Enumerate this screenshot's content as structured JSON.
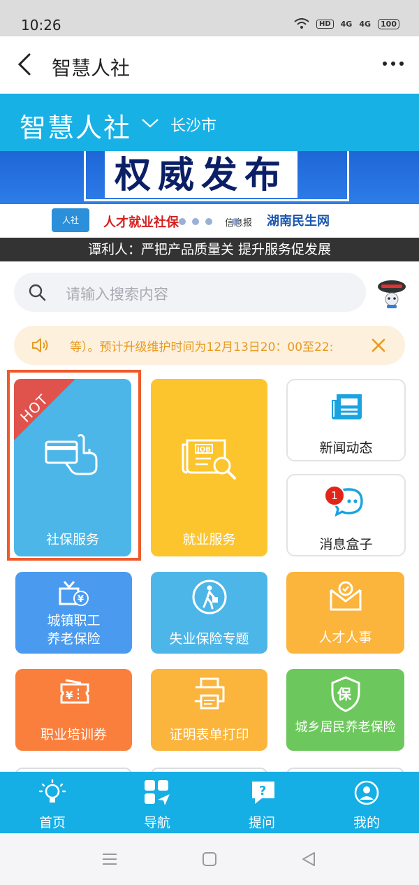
{
  "status_bar": {
    "time": "10:26",
    "hd": "HD",
    "net1": "4G",
    "net2": "4G",
    "battery": "100"
  },
  "app_bar": {
    "title": "智慧人社"
  },
  "header": {
    "brand": "智慧人社",
    "city": "长沙市"
  },
  "banner": {
    "headline": "权威发布",
    "logo_left": "人社",
    "logo_mid": "人才就业社保",
    "logo_mid_sub": "信息报",
    "logo_right": "湖南民生网",
    "slides": 5,
    "active_slide": 4
  },
  "news_caption": "谭利人：严把产品质量关 提升服务促发展",
  "search": {
    "placeholder": "请输入搜索内容"
  },
  "notice": {
    "text": "等）。预计升级维护时间为12月13日20：00至22:"
  },
  "tiles": {
    "social_insurance": {
      "label": "社保服务",
      "hot": "HOT",
      "color": "#4db6e8"
    },
    "employment": {
      "label": "就业服务",
      "color": "#fcc52e"
    },
    "news": {
      "label": "新闻动态"
    },
    "messages": {
      "label": "消息盒子",
      "badge": "1"
    },
    "urban_pension": {
      "label_line1": "城镇职工",
      "label_line2": "养老保险",
      "color": "#4a9bf0"
    },
    "unemployment": {
      "label": "失业保险专题",
      "color": "#4db6e8"
    },
    "talent": {
      "label": "人才人事",
      "color": "#fbb43c"
    },
    "training": {
      "label": "职业培训券",
      "color": "#fb7f3c"
    },
    "print": {
      "label": "证明表单打印",
      "color": "#fbb43c"
    },
    "rural_pension": {
      "label": "城乡居民养老保险",
      "color": "#6cc85c"
    }
  },
  "tab_bar": {
    "home": "首页",
    "nav": "导航",
    "ask": "提问",
    "mine": "我的"
  }
}
